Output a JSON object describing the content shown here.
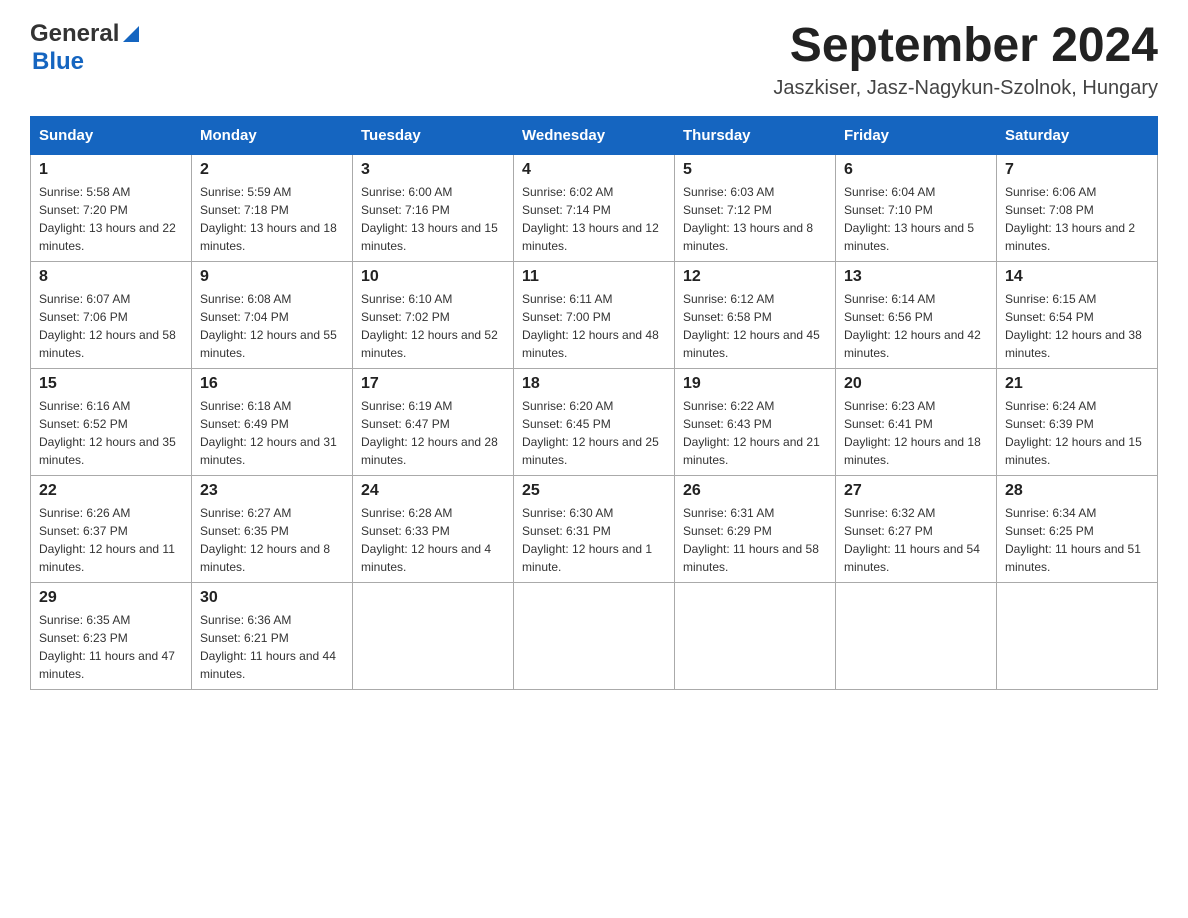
{
  "logo": {
    "general": "General",
    "blue": "Blue"
  },
  "title": "September 2024",
  "subtitle": "Jaszkiser, Jasz-Nagykun-Szolnok, Hungary",
  "weekdays": [
    "Sunday",
    "Monday",
    "Tuesday",
    "Wednesday",
    "Thursday",
    "Friday",
    "Saturday"
  ],
  "weeks": [
    [
      {
        "day": "1",
        "sunrise": "5:58 AM",
        "sunset": "7:20 PM",
        "daylight": "13 hours and 22 minutes."
      },
      {
        "day": "2",
        "sunrise": "5:59 AM",
        "sunset": "7:18 PM",
        "daylight": "13 hours and 18 minutes."
      },
      {
        "day": "3",
        "sunrise": "6:00 AM",
        "sunset": "7:16 PM",
        "daylight": "13 hours and 15 minutes."
      },
      {
        "day": "4",
        "sunrise": "6:02 AM",
        "sunset": "7:14 PM",
        "daylight": "13 hours and 12 minutes."
      },
      {
        "day": "5",
        "sunrise": "6:03 AM",
        "sunset": "7:12 PM",
        "daylight": "13 hours and 8 minutes."
      },
      {
        "day": "6",
        "sunrise": "6:04 AM",
        "sunset": "7:10 PM",
        "daylight": "13 hours and 5 minutes."
      },
      {
        "day": "7",
        "sunrise": "6:06 AM",
        "sunset": "7:08 PM",
        "daylight": "13 hours and 2 minutes."
      }
    ],
    [
      {
        "day": "8",
        "sunrise": "6:07 AM",
        "sunset": "7:06 PM",
        "daylight": "12 hours and 58 minutes."
      },
      {
        "day": "9",
        "sunrise": "6:08 AM",
        "sunset": "7:04 PM",
        "daylight": "12 hours and 55 minutes."
      },
      {
        "day": "10",
        "sunrise": "6:10 AM",
        "sunset": "7:02 PM",
        "daylight": "12 hours and 52 minutes."
      },
      {
        "day": "11",
        "sunrise": "6:11 AM",
        "sunset": "7:00 PM",
        "daylight": "12 hours and 48 minutes."
      },
      {
        "day": "12",
        "sunrise": "6:12 AM",
        "sunset": "6:58 PM",
        "daylight": "12 hours and 45 minutes."
      },
      {
        "day": "13",
        "sunrise": "6:14 AM",
        "sunset": "6:56 PM",
        "daylight": "12 hours and 42 minutes."
      },
      {
        "day": "14",
        "sunrise": "6:15 AM",
        "sunset": "6:54 PM",
        "daylight": "12 hours and 38 minutes."
      }
    ],
    [
      {
        "day": "15",
        "sunrise": "6:16 AM",
        "sunset": "6:52 PM",
        "daylight": "12 hours and 35 minutes."
      },
      {
        "day": "16",
        "sunrise": "6:18 AM",
        "sunset": "6:49 PM",
        "daylight": "12 hours and 31 minutes."
      },
      {
        "day": "17",
        "sunrise": "6:19 AM",
        "sunset": "6:47 PM",
        "daylight": "12 hours and 28 minutes."
      },
      {
        "day": "18",
        "sunrise": "6:20 AM",
        "sunset": "6:45 PM",
        "daylight": "12 hours and 25 minutes."
      },
      {
        "day": "19",
        "sunrise": "6:22 AM",
        "sunset": "6:43 PM",
        "daylight": "12 hours and 21 minutes."
      },
      {
        "day": "20",
        "sunrise": "6:23 AM",
        "sunset": "6:41 PM",
        "daylight": "12 hours and 18 minutes."
      },
      {
        "day": "21",
        "sunrise": "6:24 AM",
        "sunset": "6:39 PM",
        "daylight": "12 hours and 15 minutes."
      }
    ],
    [
      {
        "day": "22",
        "sunrise": "6:26 AM",
        "sunset": "6:37 PM",
        "daylight": "12 hours and 11 minutes."
      },
      {
        "day": "23",
        "sunrise": "6:27 AM",
        "sunset": "6:35 PM",
        "daylight": "12 hours and 8 minutes."
      },
      {
        "day": "24",
        "sunrise": "6:28 AM",
        "sunset": "6:33 PM",
        "daylight": "12 hours and 4 minutes."
      },
      {
        "day": "25",
        "sunrise": "6:30 AM",
        "sunset": "6:31 PM",
        "daylight": "12 hours and 1 minute."
      },
      {
        "day": "26",
        "sunrise": "6:31 AM",
        "sunset": "6:29 PM",
        "daylight": "11 hours and 58 minutes."
      },
      {
        "day": "27",
        "sunrise": "6:32 AM",
        "sunset": "6:27 PM",
        "daylight": "11 hours and 54 minutes."
      },
      {
        "day": "28",
        "sunrise": "6:34 AM",
        "sunset": "6:25 PM",
        "daylight": "11 hours and 51 minutes."
      }
    ],
    [
      {
        "day": "29",
        "sunrise": "6:35 AM",
        "sunset": "6:23 PM",
        "daylight": "11 hours and 47 minutes."
      },
      {
        "day": "30",
        "sunrise": "6:36 AM",
        "sunset": "6:21 PM",
        "daylight": "11 hours and 44 minutes."
      },
      null,
      null,
      null,
      null,
      null
    ]
  ]
}
